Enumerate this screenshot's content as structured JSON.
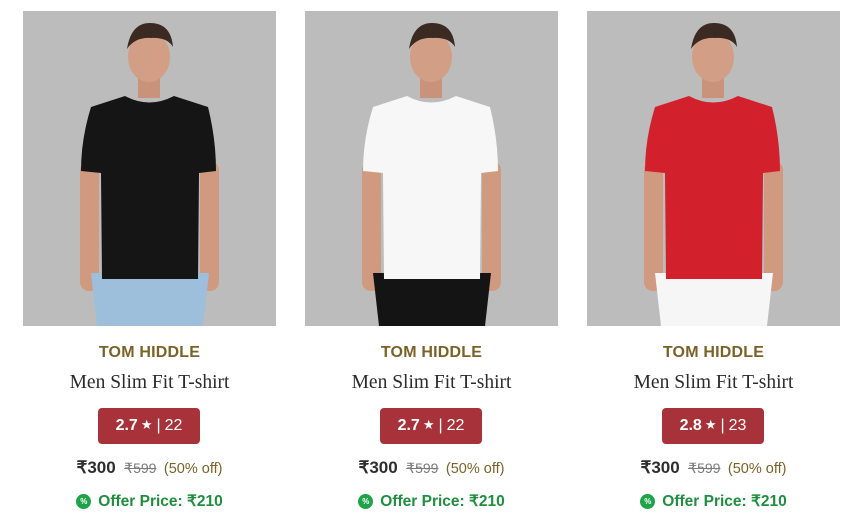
{
  "products": [
    {
      "brand": "TOM HIDDLE",
      "title": "Men Slim Fit T-shirt",
      "rating": "2.7",
      "reviews": "22",
      "price": "₹300",
      "mrp": "₹599",
      "discount": "(50% off)",
      "offer_price": "Offer Price: ₹210",
      "tshirt_color": "#151515",
      "pants_color": "#9dbfdc"
    },
    {
      "brand": "TOM HIDDLE",
      "title": "Men Slim Fit T-shirt",
      "rating": "2.7",
      "reviews": "22",
      "price": "₹300",
      "mrp": "₹599",
      "discount": "(50% off)",
      "offer_price": "Offer Price: ₹210",
      "tshirt_color": "#f7f7f7",
      "pants_color": "#141414"
    },
    {
      "brand": "TOM HIDDLE",
      "title": "Men Slim Fit T-shirt",
      "rating": "2.8",
      "reviews": "23",
      "price": "₹300",
      "mrp": "₹599",
      "discount": "(50% off)",
      "offer_price": "Offer Price: ₹210",
      "tshirt_color": "#d3202d",
      "pants_color": "#f6f6f6"
    }
  ],
  "icons": {
    "star": "star-icon",
    "offer_badge": "percent-badge-icon"
  },
  "colors": {
    "brand_text": "#7a6227",
    "rating_bg": "#a8323a",
    "offer_green": "#1f8f3f",
    "photo_bg": "#b9b9b9"
  }
}
